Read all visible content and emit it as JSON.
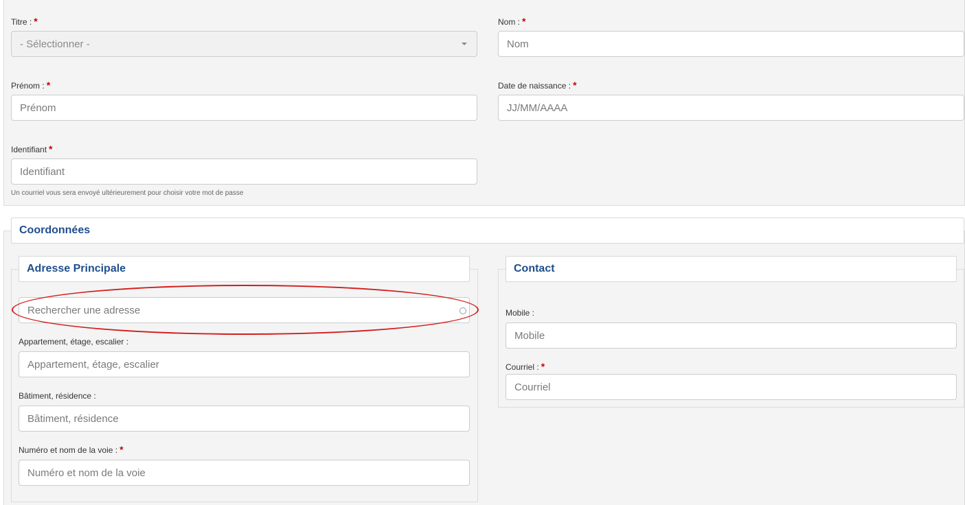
{
  "identity": {
    "title_label": "Titre :",
    "title_select_value": "- Sélectionner -",
    "nom_label": "Nom :",
    "nom_placeholder": "Nom",
    "prenom_label": "Prénom :",
    "prenom_placeholder": "Prénom",
    "birth_label": "Date de naissance :",
    "birth_placeholder": "JJ/MM/AAAA",
    "id_label": "Identifiant",
    "id_placeholder": "Identifiant",
    "id_help": "Un courriel vous sera envoyé ultérieurement pour choisir votre mot de passe",
    "required_mark": "*"
  },
  "coordonnees": {
    "title": "Coordonnées",
    "address": {
      "title": "Adresse Principale",
      "search_placeholder": "Rechercher une adresse",
      "apt_label": "Appartement, étage, escalier :",
      "apt_placeholder": "Appartement, étage, escalier",
      "bat_label": "Bâtiment, résidence :",
      "bat_placeholder": "Bâtiment, résidence",
      "street_label": "Numéro et nom de la voie :",
      "street_placeholder": "Numéro et nom de la voie"
    },
    "contact": {
      "title": "Contact",
      "mobile_label": "Mobile :",
      "mobile_placeholder": "Mobile",
      "email_label": "Courriel :",
      "email_placeholder": "Courriel"
    }
  },
  "colors": {
    "section_title": "#1f4e8c",
    "required": "#cc0000",
    "annotation": "#d41c1c"
  }
}
